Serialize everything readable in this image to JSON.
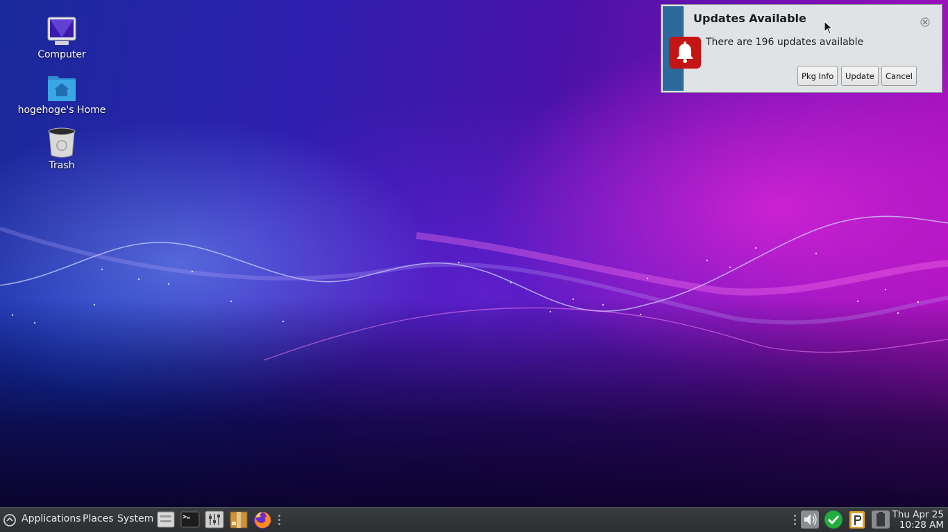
{
  "desktop": {
    "icons": [
      {
        "label": "Computer",
        "icon": "computer-monitor-icon"
      },
      {
        "label": "hogehoge's Home",
        "icon": "home-folder-icon"
      },
      {
        "label": "Trash",
        "icon": "trash-can-icon"
      }
    ]
  },
  "notification": {
    "title": "Updates Available",
    "message": "There are 196 updates available",
    "icon": "bell-icon",
    "accent_color": "#2d6a9c",
    "icon_color": "#c41414",
    "buttons": {
      "pkg_info": "Pkg Info",
      "update": "Update",
      "cancel": "Cancel"
    }
  },
  "panel": {
    "menu": {
      "applications": "Applications",
      "places": "Places",
      "system": "System"
    },
    "launchers": [
      "file-manager-icon",
      "terminal-icon",
      "settings-sliders-icon",
      "package-archive-icon",
      "firefox-icon"
    ],
    "tray": [
      "volume-icon",
      "update-check-icon",
      "clipboard-parcellite-icon",
      "power-battery-icon"
    ],
    "clock": {
      "date": "Thu Apr 25",
      "time": "10:28 AM"
    }
  }
}
